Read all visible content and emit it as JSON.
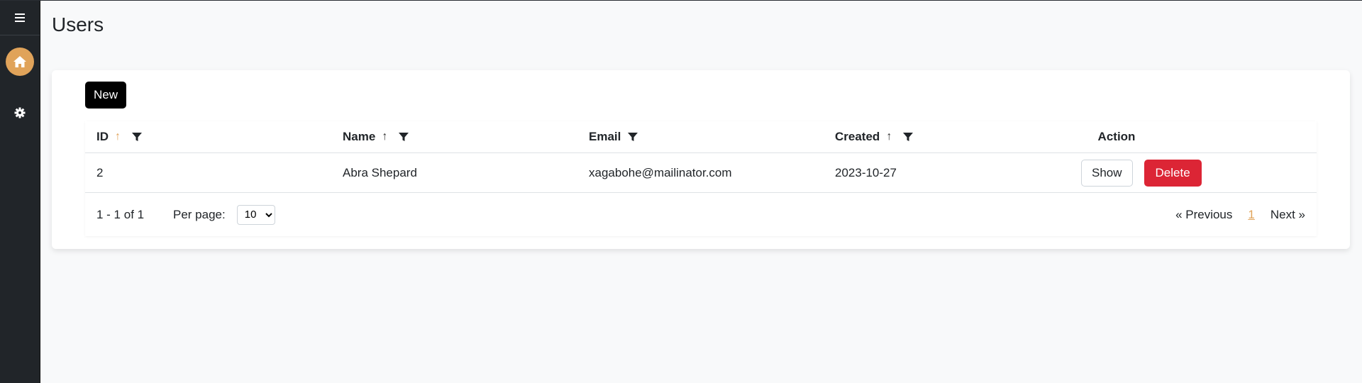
{
  "page": {
    "title": "Users"
  },
  "sidebar": {
    "menu_icon": "hamburger-icon",
    "items": [
      {
        "name": "home",
        "icon": "home-icon",
        "active": true
      },
      {
        "name": "settings",
        "icon": "gear-icon",
        "active": false
      }
    ]
  },
  "toolbar": {
    "new_label": "New"
  },
  "table": {
    "columns": [
      {
        "label": "ID",
        "sortable": true,
        "sort_active": true,
        "filterable": true
      },
      {
        "label": "Name",
        "sortable": true,
        "sort_active": false,
        "filterable": true
      },
      {
        "label": "Email",
        "sortable": false,
        "filterable": true
      },
      {
        "label": "Created",
        "sortable": true,
        "sort_active": false,
        "filterable": true
      },
      {
        "label": "Action",
        "sortable": false,
        "filterable": false
      }
    ],
    "rows": [
      {
        "id": "2",
        "name": "Abra Shepard",
        "email": "xagabohe@mailinator.com",
        "created": "2023-10-27",
        "show_label": "Show",
        "delete_label": "Delete"
      }
    ]
  },
  "pagination": {
    "range": "1 - 1 of 1",
    "per_page_label": "Per page:",
    "per_page_value": "10",
    "prev_label": "« Previous",
    "current_page": "1",
    "next_label": "Next »"
  },
  "colors": {
    "sidebar_bg": "#212529",
    "accent": "#e0a35a",
    "danger": "#dc2535",
    "primary_button": "#000000"
  }
}
